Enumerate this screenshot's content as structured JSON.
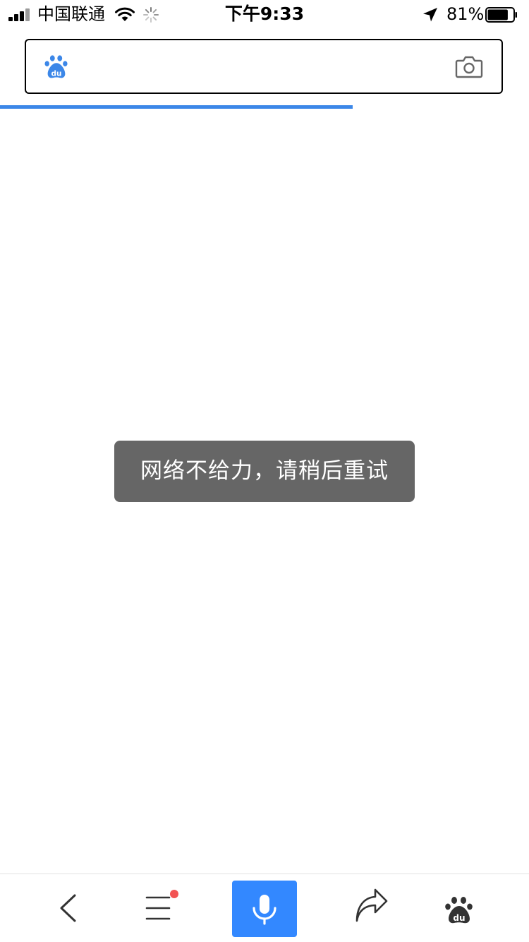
{
  "status_bar": {
    "carrier": "中国联通",
    "time": "下午9:33",
    "battery_percent": "81%",
    "battery_level": 0.81,
    "icons": [
      "signal-icon",
      "wifi-icon",
      "loading-spinner-icon",
      "location-arrow-icon",
      "battery-icon"
    ]
  },
  "search": {
    "value": "",
    "logo_icon": "baidu-paw-icon",
    "camera_icon": "camera-icon"
  },
  "page_load": {
    "progress": 0.667
  },
  "toast": {
    "message": "网络不给力，请稍后重试"
  },
  "toolbar": {
    "icons": [
      "back-chevron-icon",
      "menu-icon",
      "microphone-icon",
      "share-arrow-icon",
      "baidu-paw-icon"
    ],
    "menu_has_notification": true
  },
  "colors": {
    "accent_blue": "#3c87e8",
    "voice_button": "#3388ff",
    "toast_background": "#666666",
    "notification_red": "#f25353",
    "icon_gray": "#333333"
  }
}
